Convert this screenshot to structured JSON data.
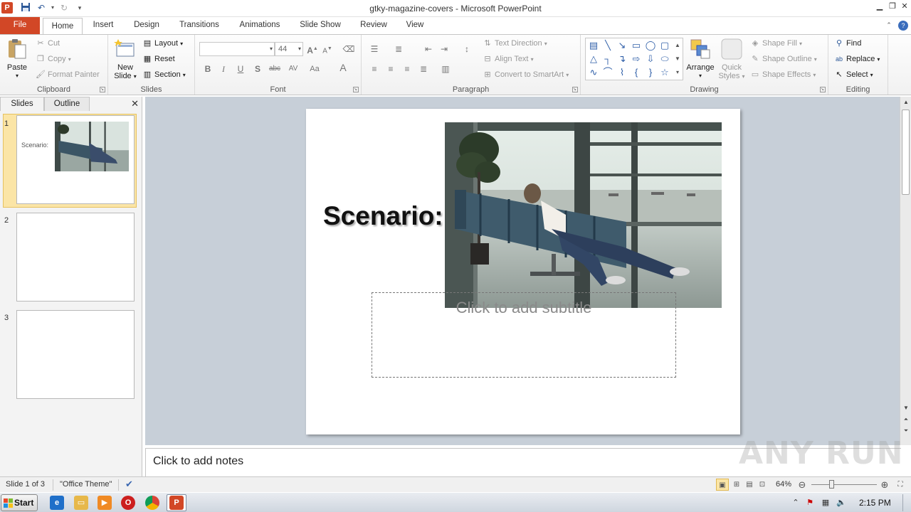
{
  "window": {
    "title": "gtky-magazine-covers  -  Microsoft PowerPoint",
    "app_icon_letter": "P"
  },
  "ribbon_tabs": [
    "File",
    "Home",
    "Insert",
    "Design",
    "Transitions",
    "Animations",
    "Slide Show",
    "Review",
    "View"
  ],
  "ribbon": {
    "clipboard": {
      "label": "Clipboard",
      "paste": "Paste",
      "cut": "Cut",
      "copy": "Copy",
      "format_painter": "Format Painter"
    },
    "slides": {
      "label": "Slides",
      "new_slide_1": "New",
      "new_slide_2": "Slide",
      "layout": "Layout",
      "reset": "Reset",
      "section": "Section"
    },
    "font": {
      "label": "Font",
      "font_name": "",
      "font_size": "44"
    },
    "paragraph": {
      "label": "Paragraph",
      "text_direction": "Text Direction",
      "align_text": "Align Text",
      "convert_smartart": "Convert to SmartArt"
    },
    "drawing": {
      "label": "Drawing",
      "arrange": "Arrange",
      "quick_styles_1": "Quick",
      "quick_styles_2": "Styles",
      "shape_fill": "Shape Fill",
      "shape_outline": "Shape Outline",
      "shape_effects": "Shape Effects"
    },
    "editing": {
      "label": "Editing",
      "find": "Find",
      "replace": "Replace",
      "select": "Select"
    }
  },
  "left_pane": {
    "tabs": [
      "Slides",
      "Outline"
    ],
    "slides": [
      {
        "number": "1",
        "title": "Scenario:"
      },
      {
        "number": "2"
      },
      {
        "number": "3"
      }
    ]
  },
  "slide": {
    "title": "Scenario:",
    "subtitle_placeholder": "Click to add subtitle"
  },
  "notes": {
    "placeholder": "Click to add notes"
  },
  "status": {
    "slide_position": "Slide 1 of 3",
    "theme": "\"Office Theme\"",
    "zoom": "64%",
    "zoom_level_percent": 64
  },
  "taskbar": {
    "start": "Start",
    "clock": "2:15 PM"
  },
  "watermark": "ANY RUN",
  "colors": {
    "file_tab": "#d24726",
    "accent": "#2b5797",
    "selection": "#fbe5a6"
  }
}
